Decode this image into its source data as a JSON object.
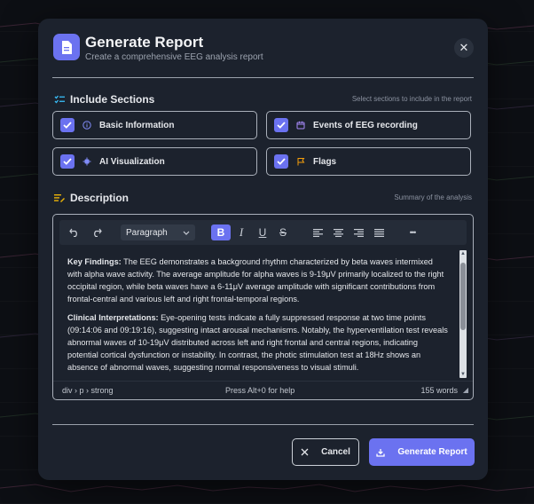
{
  "dialog": {
    "title": "Generate Report",
    "subtitle": "Create a comprehensive EEG analysis report",
    "close_label": "✕",
    "accent": "#6b72f0"
  },
  "sections": {
    "title": "Include Sections",
    "hint": "Select sections to include in the report",
    "options": [
      {
        "label": "Basic Information",
        "icon": "info-icon",
        "checked": true
      },
      {
        "label": "Events of EEG recording",
        "icon": "calendar-icon",
        "checked": true
      },
      {
        "label": "AI Visualization",
        "icon": "ai-chip-icon",
        "checked": true
      },
      {
        "label": "Flags",
        "icon": "flag-icon",
        "checked": true
      }
    ]
  },
  "description": {
    "title": "Description",
    "hint": "Summary of the analysis",
    "toolbar": {
      "block_format": "Paragraph",
      "bold": "B",
      "italic": "I",
      "underline": "U",
      "strike": "S",
      "more": "•••"
    },
    "paragraphs": [
      {
        "heading": "Key Findings:",
        "text": " The EEG demonstrates a background rhythm characterized by beta waves intermixed with alpha wave activity. The average amplitude for alpha waves is 9-19μV primarily localized to the right occipital region, while beta waves have a 6-11μV average amplitude with significant contributions from frontal-central and various left and right frontal-temporal regions."
      },
      {
        "heading": "Clinical Interpretations:",
        "text": " Eye-opening tests indicate a fully suppressed response at two time points (09:14:06 and 09:19:16), suggesting intact arousal mechanisms. Notably, the hyperventilation test reveals abnormal waves of 10-19μV distributed across left and right frontal and central regions, indicating potential cortical dysfunction or instability. In contrast, the photic stimulation test at 18Hz shows an absence of abnormal waves, suggesting normal responsiveness to visual stimuli."
      }
    ],
    "status": {
      "path": "div › p › strong",
      "help": "Press Alt+0 for help",
      "word_count": "155 words"
    }
  },
  "footer": {
    "cancel_label": "Cancel",
    "generate_label": "Generate Report"
  }
}
